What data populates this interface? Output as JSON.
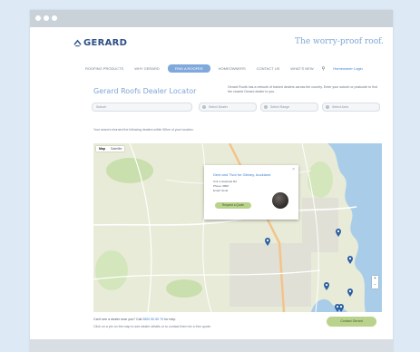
{
  "window": {
    "title": ""
  },
  "header": {
    "logo_text": "GERARD",
    "tagline": "The worry-proof roof."
  },
  "nav": {
    "items": [
      {
        "label": "ROOFING PRODUCTS",
        "active": false
      },
      {
        "label": "WHY GERARD",
        "active": false
      },
      {
        "label": "FIND A ROOFER",
        "active": true
      },
      {
        "label": "HOMEOWNERS",
        "active": false
      },
      {
        "label": "CONTACT US",
        "active": false
      },
      {
        "label": "WHAT'S NEW",
        "active": false
      }
    ],
    "search_icon": "search-icon",
    "extra_link": "Homeowner Login"
  },
  "locator": {
    "title": "Gerard Roofs Dealer Locator",
    "intro": "Gerard Roofs has a network of trained dealers across the country. Enter your suburb or postcode to find the closest Gerard dealer to you."
  },
  "filters": {
    "search_placeholder": "Suburb",
    "select_1": "Select Dealer",
    "select_2": "Select Range",
    "select_3": "Select Area"
  },
  "map_note": "Your search returned the following dealers within 50km of your location.",
  "map": {
    "toggle_map": "Map",
    "toggle_satellite": "Satellite",
    "popup": {
      "title": "Dent and Tivol for Gibney, Auckland",
      "line1": "Unit 4, Example Rd",
      "line2": "Phone: 0800",
      "line3": "Email: Send",
      "button": "Request a Quote",
      "close": "×"
    },
    "zoom_in": "+",
    "zoom_out": "−",
    "pin_color": "#2e5fa3"
  },
  "footer": {
    "line1_prefix": "Can't see a dealer near you? Call",
    "line1_link": "0800 50 60 70",
    "line1_suffix": "for help.",
    "line2": "Click on a pin on the map to see dealer details or to contact them for a free quote.",
    "contact_button": "Contact Gerard"
  },
  "colors": {
    "accent": "#7fa8dc",
    "brand": "#2d4f86",
    "cta": "#b9d38c"
  }
}
